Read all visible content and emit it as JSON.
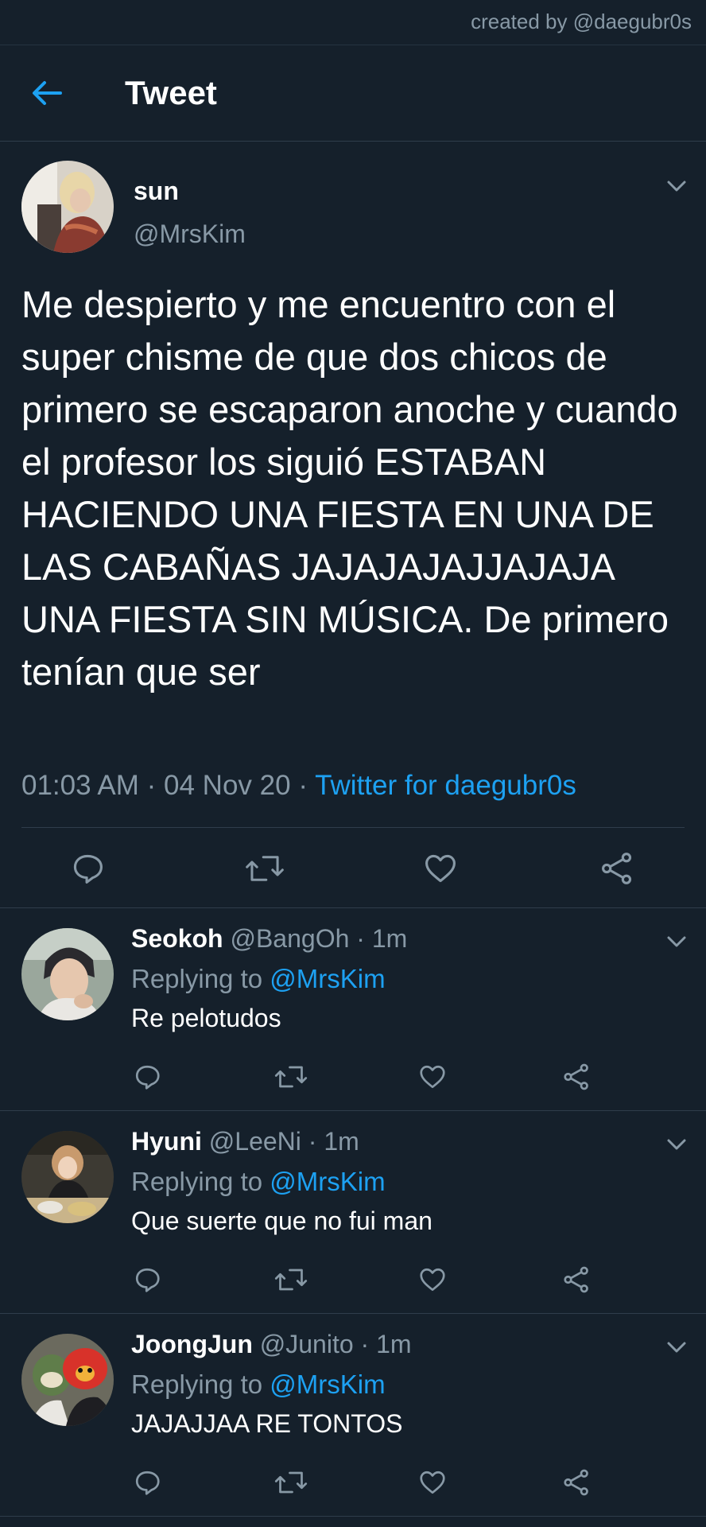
{
  "credit": "created by @daegubr0s",
  "header": {
    "back_icon": "arrow-left-icon",
    "title": "Tweet"
  },
  "main_tweet": {
    "name": "sun",
    "handle": "@MrsKim",
    "text": "Me despierto y me encuentro con el super chisme de que dos chicos de primero se escaparon anoche y cuando el profesor los siguió ESTABAN HACIENDO UNA FIESTA EN UNA DE LAS CABAÑAS JAJAJAJAJJAJAJA UNA FIESTA SIN MÚSICA. De primero tenían que ser",
    "time": "01:03 AM",
    "date": "04 Nov 20",
    "separator": "·",
    "source": "Twitter for daegubr0s",
    "actions": [
      "reply-icon",
      "retweet-icon",
      "like-icon",
      "share-icon"
    ]
  },
  "replies": [
    {
      "name": "Seokoh",
      "handle": "@BangOh",
      "time": "· 1m",
      "replying_label": "Replying to",
      "mention": "@MrsKim",
      "text": "Re pelotudos"
    },
    {
      "name": "Hyuni",
      "handle": "@LeeNi",
      "time": "· 1m",
      "replying_label": "Replying to",
      "mention": "@MrsKim",
      "text": "Que suerte que no fui man"
    },
    {
      "name": "JoongJun",
      "handle": "@Junito",
      "time": "· 1m",
      "replying_label": "Replying to",
      "mention": "@MrsKim",
      "text": "JAJAJJAA RE TONTOS"
    }
  ],
  "colors": {
    "background": "#15202b",
    "accent": "#1da1f2",
    "secondary_text": "#8899a6",
    "divider": "#2f3d4b"
  }
}
